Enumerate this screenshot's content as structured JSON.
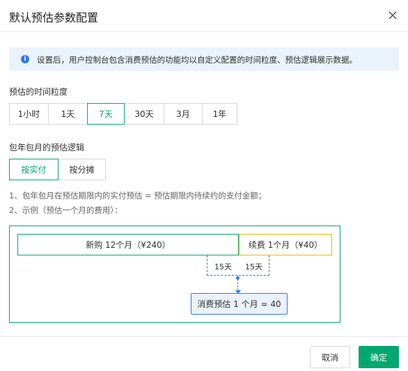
{
  "dialog": {
    "title": "默认预估参数配置",
    "close_icon": "close-icon"
  },
  "info": {
    "icon": "info-icon",
    "icon_glyph": "i",
    "text": "设置后，用户控制台包含消费预估的功能均以自定义配置的时间粒度、预估逻辑展示数据。"
  },
  "time_granularity": {
    "label": "预估的时间粒度",
    "options": [
      "1小时",
      "1天",
      "7天",
      "30天",
      "3月",
      "1年"
    ],
    "selected": "7天"
  },
  "logic": {
    "label": "包年包月的预估逻辑",
    "options": [
      "按实付",
      "按分摊"
    ],
    "selected": "按实付"
  },
  "notes": {
    "line1": "1、包年包月在预估期限内的实付预估 = 预估期限内待续约的支付金额；",
    "line2": "2、示例（预估一个月的费用）："
  },
  "diagram": {
    "new_purchase": "新购 12个月（¥240）",
    "renewal": "续费 1个月（¥40）",
    "left_days": "15天",
    "right_days": "15天",
    "result": "消费预估 1 个月 = 40"
  },
  "footer": {
    "cancel_label": "取消",
    "ok_label": "确定"
  },
  "colors": {
    "accent": "#00a870",
    "info_blue": "#2d7be6",
    "renewal_yellow": "#f5b300"
  }
}
